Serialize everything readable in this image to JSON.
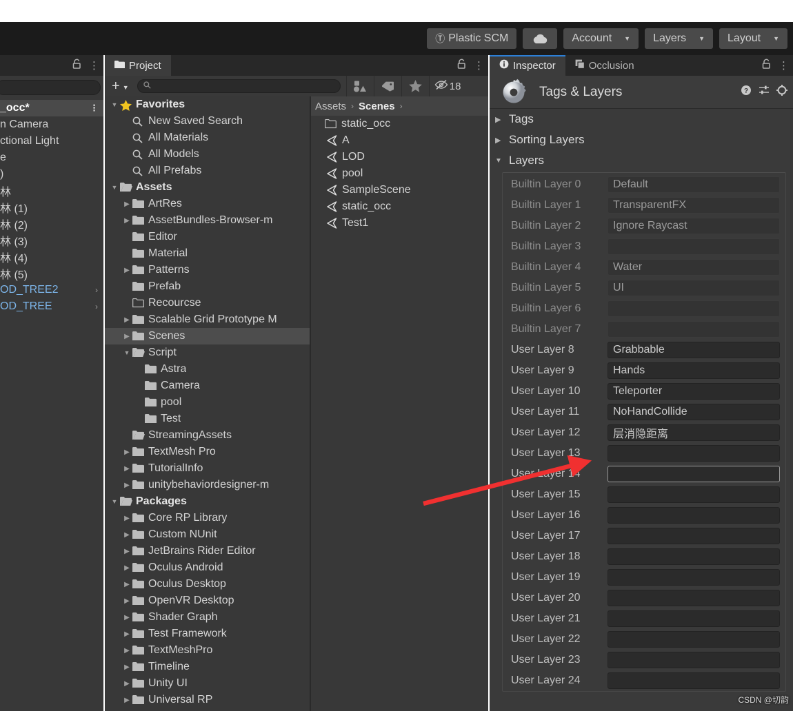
{
  "toolbar": {
    "plastic_scm": "Plastic SCM",
    "cloud_icon": "cloud-icon",
    "account": "Account",
    "layers": "Layers",
    "layout": "Layout"
  },
  "hierarchy": {
    "tab_label": "",
    "search_value": "",
    "items": [
      {
        "label": "_occ*",
        "selected": true,
        "prefab": false,
        "kebab": true
      },
      {
        "label": "n Camera",
        "selected": false,
        "prefab": false
      },
      {
        "label": "ctional Light",
        "selected": false,
        "prefab": false
      },
      {
        "label": "e",
        "selected": false,
        "prefab": false
      },
      {
        "label": ")",
        "selected": false,
        "prefab": false
      },
      {
        "label": "林",
        "selected": false,
        "prefab": false
      },
      {
        "label": "林 (1)",
        "selected": false,
        "prefab": false
      },
      {
        "label": "林 (2)",
        "selected": false,
        "prefab": false
      },
      {
        "label": "林 (3)",
        "selected": false,
        "prefab": false
      },
      {
        "label": "林 (4)",
        "selected": false,
        "prefab": false
      },
      {
        "label": "林 (5)",
        "selected": false,
        "prefab": false
      },
      {
        "label": "OD_TREE2",
        "selected": false,
        "prefab": true,
        "chevron": "›"
      },
      {
        "label": "OD_TREE",
        "selected": false,
        "prefab": true,
        "chevron": "›"
      }
    ]
  },
  "project": {
    "tab_label": "Project",
    "create_label": "+",
    "search_placeholder": "",
    "search_value": "",
    "hidden_count": "18",
    "tree": [
      {
        "label": "Favorites",
        "indent": 0,
        "twisty": "down",
        "icon": "star",
        "bold": true
      },
      {
        "label": "New Saved Search",
        "indent": 1,
        "twisty": "none",
        "icon": "search",
        "bold": false
      },
      {
        "label": "All Materials",
        "indent": 1,
        "twisty": "none",
        "icon": "search",
        "bold": false
      },
      {
        "label": "All Models",
        "indent": 1,
        "twisty": "none",
        "icon": "search",
        "bold": false
      },
      {
        "label": "All Prefabs",
        "indent": 1,
        "twisty": "none",
        "icon": "search",
        "bold": false
      },
      {
        "label": "Assets",
        "indent": 0,
        "twisty": "down",
        "icon": "folder-open",
        "bold": true
      },
      {
        "label": "ArtRes",
        "indent": 1,
        "twisty": "right",
        "icon": "folder",
        "bold": false
      },
      {
        "label": "AssetBundles-Browser-m",
        "indent": 1,
        "twisty": "right",
        "icon": "folder",
        "bold": false
      },
      {
        "label": "Editor",
        "indent": 1,
        "twisty": "none",
        "icon": "folder",
        "bold": false
      },
      {
        "label": "Material",
        "indent": 1,
        "twisty": "none",
        "icon": "folder",
        "bold": false
      },
      {
        "label": "Patterns",
        "indent": 1,
        "twisty": "right",
        "icon": "folder",
        "bold": false
      },
      {
        "label": "Prefab",
        "indent": 1,
        "twisty": "none",
        "icon": "folder",
        "bold": false
      },
      {
        "label": "Recourcse",
        "indent": 1,
        "twisty": "none",
        "icon": "folder-empty",
        "bold": false
      },
      {
        "label": "Scalable Grid Prototype M",
        "indent": 1,
        "twisty": "right",
        "icon": "folder",
        "bold": false
      },
      {
        "label": "Scenes",
        "indent": 1,
        "twisty": "right",
        "icon": "folder",
        "bold": false,
        "selected": true
      },
      {
        "label": "Script",
        "indent": 1,
        "twisty": "down",
        "icon": "folder-open",
        "bold": false
      },
      {
        "label": "Astra",
        "indent": 2,
        "twisty": "none",
        "icon": "folder",
        "bold": false
      },
      {
        "label": "Camera",
        "indent": 2,
        "twisty": "none",
        "icon": "folder",
        "bold": false
      },
      {
        "label": "pool",
        "indent": 2,
        "twisty": "none",
        "icon": "folder",
        "bold": false
      },
      {
        "label": "Test",
        "indent": 2,
        "twisty": "none",
        "icon": "folder",
        "bold": false
      },
      {
        "label": "StreamingAssets",
        "indent": 1,
        "twisty": "none",
        "icon": "folder-open",
        "bold": false
      },
      {
        "label": "TextMesh Pro",
        "indent": 1,
        "twisty": "right",
        "icon": "folder",
        "bold": false
      },
      {
        "label": "TutorialInfo",
        "indent": 1,
        "twisty": "right",
        "icon": "folder",
        "bold": false
      },
      {
        "label": "unitybehaviordesigner-m",
        "indent": 1,
        "twisty": "right",
        "icon": "folder",
        "bold": false
      },
      {
        "label": "Packages",
        "indent": 0,
        "twisty": "down",
        "icon": "folder-open",
        "bold": true
      },
      {
        "label": "Core RP Library",
        "indent": 1,
        "twisty": "right",
        "icon": "folder",
        "bold": false
      },
      {
        "label": "Custom NUnit",
        "indent": 1,
        "twisty": "right",
        "icon": "folder",
        "bold": false
      },
      {
        "label": "JetBrains Rider Editor",
        "indent": 1,
        "twisty": "right",
        "icon": "folder",
        "bold": false
      },
      {
        "label": "Oculus Android",
        "indent": 1,
        "twisty": "right",
        "icon": "folder",
        "bold": false
      },
      {
        "label": "Oculus Desktop",
        "indent": 1,
        "twisty": "right",
        "icon": "folder",
        "bold": false
      },
      {
        "label": "OpenVR Desktop",
        "indent": 1,
        "twisty": "right",
        "icon": "folder",
        "bold": false
      },
      {
        "label": "Shader Graph",
        "indent": 1,
        "twisty": "right",
        "icon": "folder",
        "bold": false
      },
      {
        "label": "Test Framework",
        "indent": 1,
        "twisty": "right",
        "icon": "folder",
        "bold": false
      },
      {
        "label": "TextMeshPro",
        "indent": 1,
        "twisty": "right",
        "icon": "folder",
        "bold": false
      },
      {
        "label": "Timeline",
        "indent": 1,
        "twisty": "right",
        "icon": "folder",
        "bold": false
      },
      {
        "label": "Unity UI",
        "indent": 1,
        "twisty": "right",
        "icon": "folder",
        "bold": false
      },
      {
        "label": "Universal RP",
        "indent": 1,
        "twisty": "right",
        "icon": "folder",
        "bold": false
      }
    ],
    "breadcrumb": [
      "Assets",
      "Scenes"
    ],
    "assets": [
      {
        "label": "static_occ",
        "icon": "folder-empty"
      },
      {
        "label": "A",
        "icon": "unity-scene"
      },
      {
        "label": "LOD",
        "icon": "unity-scene"
      },
      {
        "label": "pool",
        "icon": "unity-scene"
      },
      {
        "label": "SampleScene",
        "icon": "unity-scene"
      },
      {
        "label": "static_occ",
        "icon": "unity-scene"
      },
      {
        "label": "Test1",
        "icon": "unity-scene"
      }
    ]
  },
  "inspector": {
    "tabs": [
      {
        "label": "Inspector",
        "icon": "info-icon",
        "active": true
      },
      {
        "label": "Occlusion",
        "icon": "occlusion-icon",
        "active": false
      }
    ],
    "title": "Tags & Layers",
    "header_icons": [
      "help-icon",
      "preset-icon",
      "gear-icon"
    ],
    "sections": [
      {
        "label": "Tags",
        "expanded": false
      },
      {
        "label": "Sorting Layers",
        "expanded": false
      },
      {
        "label": "Layers",
        "expanded": true
      }
    ],
    "layers": [
      {
        "name": "Builtin Layer 0",
        "value": "Default",
        "builtin": true,
        "focused": false
      },
      {
        "name": "Builtin Layer 1",
        "value": "TransparentFX",
        "builtin": true,
        "focused": false
      },
      {
        "name": "Builtin Layer 2",
        "value": "Ignore Raycast",
        "builtin": true,
        "focused": false
      },
      {
        "name": "Builtin Layer 3",
        "value": "",
        "builtin": true,
        "focused": false
      },
      {
        "name": "Builtin Layer 4",
        "value": "Water",
        "builtin": true,
        "focused": false
      },
      {
        "name": "Builtin Layer 5",
        "value": "UI",
        "builtin": true,
        "focused": false
      },
      {
        "name": "Builtin Layer 6",
        "value": "",
        "builtin": true,
        "focused": false
      },
      {
        "name": "Builtin Layer 7",
        "value": "",
        "builtin": true,
        "focused": false
      },
      {
        "name": "User Layer 8",
        "value": "Grabbable",
        "builtin": false,
        "focused": false
      },
      {
        "name": "User Layer 9",
        "value": "Hands",
        "builtin": false,
        "focused": false
      },
      {
        "name": "User Layer 10",
        "value": "Teleporter",
        "builtin": false,
        "focused": false
      },
      {
        "name": "User Layer 11",
        "value": "NoHandCollide",
        "builtin": false,
        "focused": false
      },
      {
        "name": "User Layer 12",
        "value": "层消隐距离",
        "builtin": false,
        "focused": false
      },
      {
        "name": "User Layer 13",
        "value": "",
        "builtin": false,
        "focused": false
      },
      {
        "name": "User Layer 14",
        "value": "",
        "builtin": false,
        "focused": true
      },
      {
        "name": "User Layer 15",
        "value": "",
        "builtin": false,
        "focused": false
      },
      {
        "name": "User Layer 16",
        "value": "",
        "builtin": false,
        "focused": false
      },
      {
        "name": "User Layer 17",
        "value": "",
        "builtin": false,
        "focused": false
      },
      {
        "name": "User Layer 18",
        "value": "",
        "builtin": false,
        "focused": false
      },
      {
        "name": "User Layer 19",
        "value": "",
        "builtin": false,
        "focused": false
      },
      {
        "name": "User Layer 20",
        "value": "",
        "builtin": false,
        "focused": false
      },
      {
        "name": "User Layer 21",
        "value": "",
        "builtin": false,
        "focused": false
      },
      {
        "name": "User Layer 22",
        "value": "",
        "builtin": false,
        "focused": false
      },
      {
        "name": "User Layer 23",
        "value": "",
        "builtin": false,
        "focused": false
      },
      {
        "name": "User Layer 24",
        "value": "",
        "builtin": false,
        "focused": false
      }
    ]
  },
  "annotation": {
    "arrow_color": "#f03030",
    "points_to": "User Layer 12"
  },
  "watermark": "CSDN @切韵",
  "colors": {
    "panel_bg": "#383838",
    "tabbar_bg": "#282828",
    "field_bg": "#2b2b2b",
    "accent_blue": "#2c7fd6",
    "prefab_blue": "#7cb4e8",
    "arrow_red": "#f03030"
  }
}
